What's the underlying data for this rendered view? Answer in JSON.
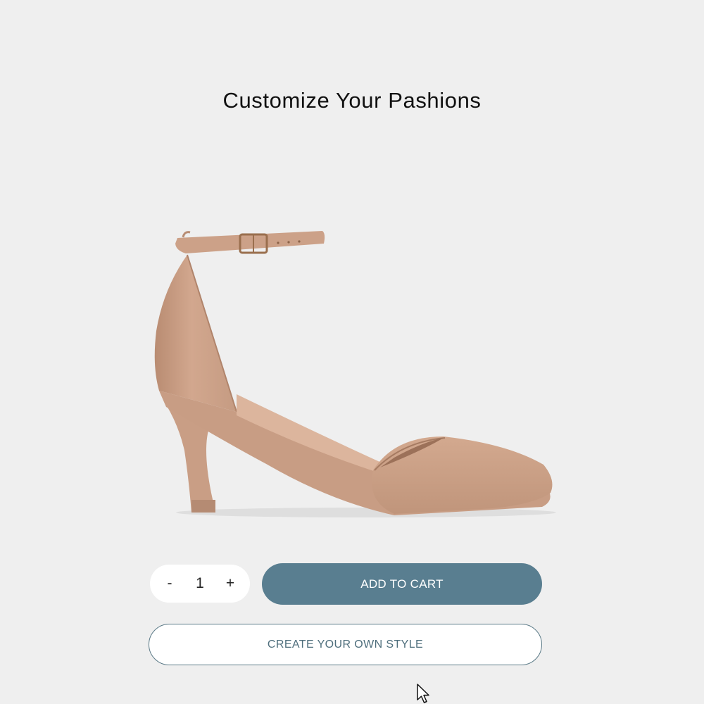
{
  "page": {
    "title": "Customize Your Pashions"
  },
  "product": {
    "image_icon": "high-heel-shoe",
    "color": "#caa08a"
  },
  "quantity": {
    "decrease_label": "-",
    "value": "1",
    "increase_label": "+"
  },
  "actions": {
    "add_to_cart_label": "ADD TO CART",
    "create_style_label": "CREATE YOUR OWN STYLE"
  },
  "colors": {
    "background": "#efefef",
    "primary_button": "#597e90",
    "outline_button_border": "#5b7a87"
  }
}
